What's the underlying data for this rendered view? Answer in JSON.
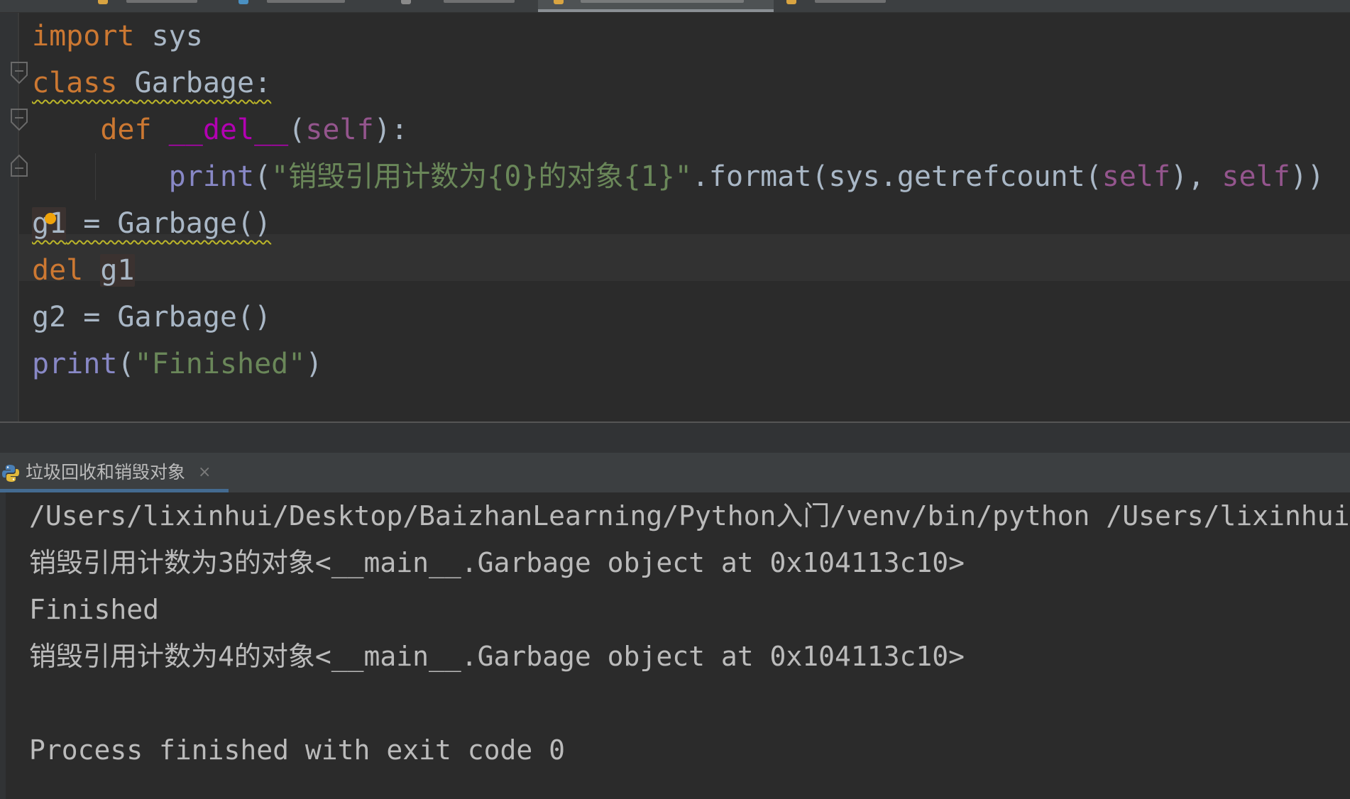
{
  "editor": {
    "lines": [
      [
        {
          "t": "import",
          "c": "kw"
        },
        {
          "t": " sys",
          "c": "id"
        }
      ],
      [
        {
          "t": "class",
          "c": "kw",
          "w": true
        },
        {
          "t": " ",
          "c": "id",
          "w": true
        },
        {
          "t": "Garbage",
          "c": "id",
          "w": true
        },
        {
          "t": ":",
          "c": "punc",
          "w": true
        }
      ],
      [
        {
          "t": "    ",
          "c": "id"
        },
        {
          "t": "def",
          "c": "kw"
        },
        {
          "t": " ",
          "c": "id"
        },
        {
          "t": "__del__",
          "c": "dund"
        },
        {
          "t": "(",
          "c": "punc"
        },
        {
          "t": "self",
          "c": "self"
        },
        {
          "t": "):",
          "c": "punc"
        }
      ],
      [
        {
          "t": "        ",
          "c": "id"
        },
        {
          "t": "print",
          "c": "bi"
        },
        {
          "t": "(",
          "c": "punc"
        },
        {
          "t": "\"销毁引用计数为{0}的对象{1}\"",
          "c": "str"
        },
        {
          "t": ".format(sys.getrefcount(",
          "c": "id"
        },
        {
          "t": "self",
          "c": "self"
        },
        {
          "t": "), ",
          "c": "punc"
        },
        {
          "t": "self",
          "c": "self"
        },
        {
          "t": "))",
          "c": "punc"
        }
      ],
      [
        {
          "t": "g1",
          "c": "id",
          "w": true,
          "h": true
        },
        {
          "t": " = Garbage()",
          "c": "id",
          "w": true
        }
      ],
      [
        {
          "t": "del",
          "c": "kw"
        },
        {
          "t": " ",
          "c": "id"
        },
        {
          "t": "g1",
          "c": "id",
          "h": true
        }
      ],
      [
        {
          "t": "g2 = Garbage()",
          "c": "id"
        }
      ],
      [
        {
          "t": "print",
          "c": "bi"
        },
        {
          "t": "(",
          "c": "punc"
        },
        {
          "t": "\"Finished\"",
          "c": "str"
        },
        {
          "t": ")",
          "c": "punc"
        }
      ]
    ]
  },
  "run_panel": {
    "tab_title": "垃圾回收和销毁对象",
    "close_glyph": "×",
    "icon": "python-icon",
    "output": [
      "/Users/lixinhui/Desktop/BaizhanLearning/Python入门/venv/bin/python /Users/lixinhui/Desktop/BaizhanLearning/Python入门/垃圾回收和销毁对象.py",
      "销毁引用计数为3的对象<__main__.Garbage object at 0x104113c10>",
      "Finished",
      "销毁引用计数为4的对象<__main__.Garbage object at 0x104113c10>",
      "",
      "Process finished with exit code 0"
    ]
  },
  "colors": {
    "background": "#2b2b2b",
    "keyword": "#cc7832",
    "identifier": "#a9b7c6",
    "dunder": "#b200b2",
    "self": "#94558d",
    "builtin": "#8888c6",
    "string": "#6a8759",
    "warning_underline": "#bbb529",
    "console_text": "#bbbbbb"
  }
}
